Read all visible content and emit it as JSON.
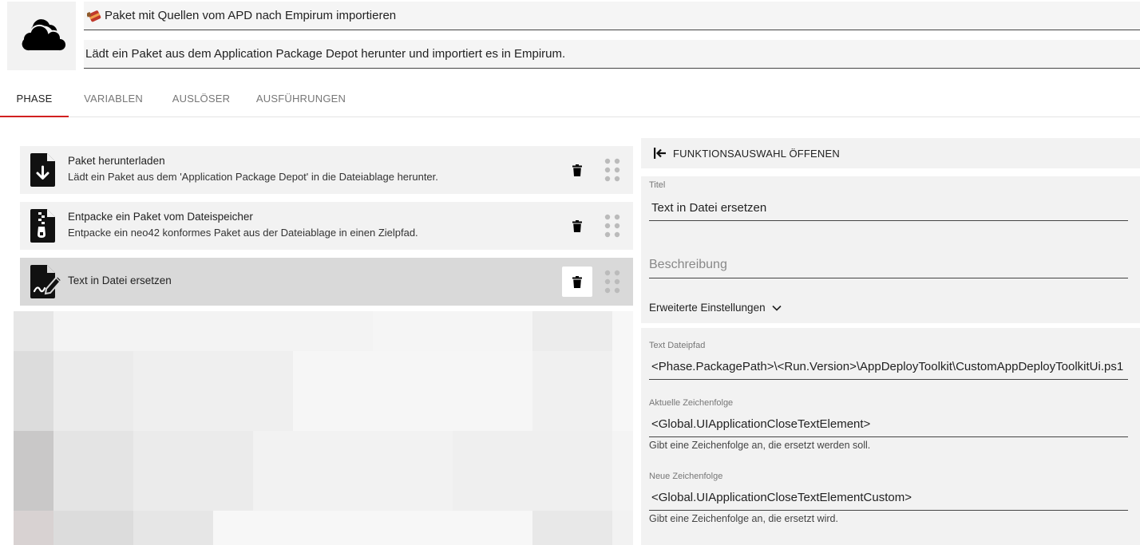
{
  "header": {
    "title": "Paket mit Quellen vom APD nach Empirum importieren",
    "description": "Lädt ein Paket aus dem Application Package Depot herunter und importiert es in Empirum.",
    "logo_icon": "cloud-icon"
  },
  "tabs": [
    {
      "label": "PHASE",
      "active": true
    },
    {
      "label": "VARIABLEN",
      "active": false
    },
    {
      "label": "AUSLÖSER",
      "active": false
    },
    {
      "label": "AUSFÜHRUNGEN",
      "active": false
    }
  ],
  "steps": [
    {
      "name": "Paket herunterladen",
      "description": "Lädt ein Paket aus dem 'Application Package Depot' in die Dateiablage herunter.",
      "icon": "file-download-icon"
    },
    {
      "name": "Entpacke ein Paket vom Dateispeicher",
      "description": "Entpacke ein neo42 konformes Paket aus der Dateiablage in einen Zielpfad.",
      "icon": "file-zip-icon"
    },
    {
      "name": "Text in Datei ersetzen",
      "description": "",
      "icon": "file-edit-icon",
      "selected": true
    }
  ],
  "panel": {
    "open_button": "FUNKTIONSAUSWAHL ÖFFENEN",
    "title_label": "Titel",
    "title_value": "Text in Datei ersetzen",
    "description_placeholder": "Beschreibung",
    "advanced_label": "Erweiterte Einstellungen",
    "path_label": "Text Dateipfad",
    "path_value": "<Phase.PackagePath>\\<Run.Version>\\AppDeployToolkit\\CustomAppDeployToolkitUi.ps1",
    "current_label": "Aktuelle Zeichenfolge",
    "current_value": "<Global.UIApplicationCloseTextElement>",
    "current_hint": "Gibt eine Zeichenfolge an, die ersetzt werden soll.",
    "new_label": "Neue Zeichenfolge",
    "new_value": "<Global.UIApplicationCloseTextElementCustom>",
    "new_hint": "Gibt eine Zeichenfolge an, die ersetzt wird."
  },
  "colors": {
    "accent": "#d21f1f",
    "panel_bg": "#f2f2f2",
    "selected_bg": "#d9d9d9"
  }
}
